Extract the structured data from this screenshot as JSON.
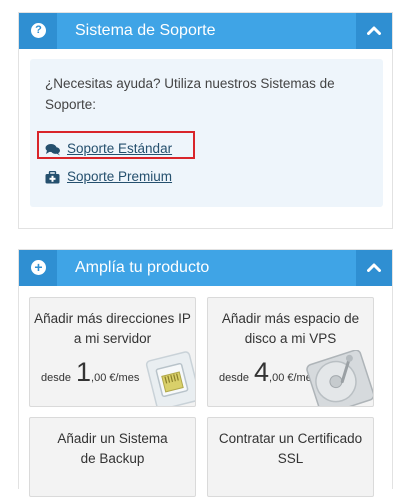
{
  "support_panel": {
    "title": "Sistema de Soporte",
    "help_text": "¿Necesitas ayuda? Utiliza nuestros Sistemas de Soporte:",
    "links": [
      {
        "label": "Soporte Estándar",
        "icon": "comments-icon",
        "highlighted": true
      },
      {
        "label": "Soporte Premium",
        "icon": "medkit-icon",
        "highlighted": false
      }
    ]
  },
  "product_panel": {
    "title": "Amplía tu producto",
    "cards": [
      {
        "title": "Añadir más direcciones IP a mi servidor",
        "price_prefix": "desde",
        "price_int": "1",
        "price_dec": ",00 €/mes",
        "icon": "network-port-icon"
      },
      {
        "title": "Añadir más espacio de disco a mi VPS",
        "price_prefix": "desde",
        "price_int": "4",
        "price_dec": ",00 €/mes",
        "icon": "hard-disk-icon"
      },
      {
        "title": "Añadir un Sistema de Backup"
      },
      {
        "title": "Contratar un Certificado SSL"
      }
    ]
  },
  "colors": {
    "header_blue": "#3fa4e6",
    "header_dark_blue": "#2f8fd2",
    "link": "#25506e",
    "highlight": "#d9252a",
    "card_bg": "#f3f3f3"
  }
}
